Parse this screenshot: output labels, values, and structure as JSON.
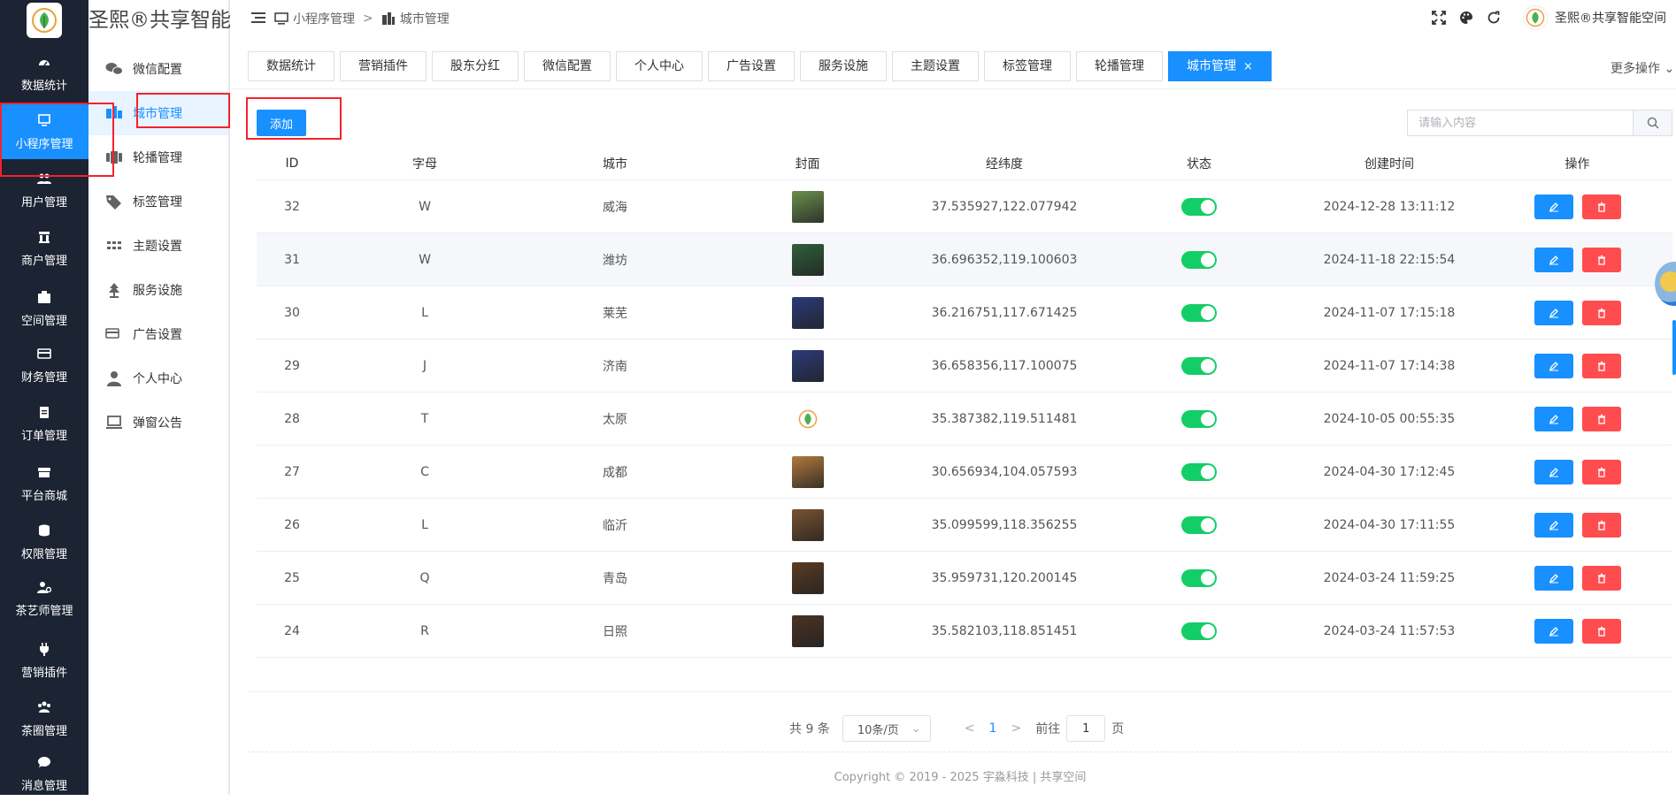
{
  "brand": {
    "name": "圣熙®共享智能..."
  },
  "rail": {
    "items": [
      {
        "label": "数据统计",
        "icon": "dashboard-icon"
      },
      {
        "label": "小程序管理",
        "icon": "monitor-icon",
        "active": true
      },
      {
        "label": "用户管理",
        "icon": "users-icon"
      },
      {
        "label": "商户管理",
        "icon": "building-icon"
      },
      {
        "label": "空间管理",
        "icon": "box-icon"
      },
      {
        "label": "财务管理",
        "icon": "card-icon"
      },
      {
        "label": "订单管理",
        "icon": "clipboard-icon"
      },
      {
        "label": "平台商城",
        "icon": "store-icon"
      },
      {
        "label": "权限管理",
        "icon": "database-icon"
      },
      {
        "label": "茶艺师管理",
        "icon": "user-gear-icon"
      },
      {
        "label": "营销插件",
        "icon": "plug-icon"
      },
      {
        "label": "茶圈管理",
        "icon": "group-icon"
      },
      {
        "label": "消息管理",
        "icon": "chat-icon"
      }
    ]
  },
  "submenu": {
    "items": [
      {
        "label": "微信配置",
        "icon": "wechat-icon"
      },
      {
        "label": "城市管理",
        "icon": "city-icon",
        "active": true
      },
      {
        "label": "轮播管理",
        "icon": "carousel-icon"
      },
      {
        "label": "标签管理",
        "icon": "tag-icon"
      },
      {
        "label": "主题设置",
        "icon": "grid-icon"
      },
      {
        "label": "服务设施",
        "icon": "tree-icon"
      },
      {
        "label": "广告设置",
        "icon": "card-icon"
      },
      {
        "label": "个人中心",
        "icon": "person-icon"
      },
      {
        "label": "弹窗公告",
        "icon": "laptop-icon"
      }
    ]
  },
  "breadcrumb": {
    "parent": "小程序管理",
    "separator": ">",
    "current": "城市管理"
  },
  "user": {
    "name": "圣熙®共享智能空间"
  },
  "tabs": {
    "items": [
      "数据统计",
      "营销插件",
      "股东分红",
      "微信配置",
      "个人中心",
      "广告设置",
      "服务设施",
      "主题设置",
      "标签管理",
      "轮播管理"
    ],
    "active_label": "城市管理",
    "close_glyph": "×",
    "more_label": "更多操作"
  },
  "toolbar": {
    "add_label": "添加",
    "search_placeholder": "请输入内容"
  },
  "table": {
    "columns": [
      "ID",
      "字母",
      "城市",
      "封面",
      "经纬度",
      "状态",
      "创建时间",
      "操作"
    ],
    "rows": [
      {
        "id": "32",
        "letter": "W",
        "city": "威海",
        "geo": "37.535927,122.077942",
        "status_on": true,
        "created": "2024-12-28 13:11:12",
        "cover_color": "#6b8f4e"
      },
      {
        "id": "31",
        "letter": "W",
        "city": "潍坊",
        "geo": "36.696352,119.100603",
        "status_on": true,
        "created": "2024-11-18 22:15:54",
        "cover_color": "#2f5f3a"
      },
      {
        "id": "30",
        "letter": "L",
        "city": "莱芜",
        "geo": "36.216751,117.671425",
        "status_on": true,
        "created": "2024-11-07 17:15:18",
        "cover_color": "#2b3a7a"
      },
      {
        "id": "29",
        "letter": "J",
        "city": "济南",
        "geo": "36.658356,117.100075",
        "status_on": true,
        "created": "2024-11-07 17:14:38",
        "cover_color": "#2b3a7a"
      },
      {
        "id": "28",
        "letter": "T",
        "city": "太原",
        "geo": "35.387382,119.511481",
        "status_on": true,
        "created": "2024-10-05 00:55:35",
        "cover_color": "logo"
      },
      {
        "id": "27",
        "letter": "C",
        "city": "成都",
        "geo": "30.656934,104.057593",
        "status_on": true,
        "created": "2024-04-30 17:12:45",
        "cover_color": "#b0793d"
      },
      {
        "id": "26",
        "letter": "L",
        "city": "临沂",
        "geo": "35.099599,118.356255",
        "status_on": true,
        "created": "2024-04-30 17:11:55",
        "cover_color": "#7a5232"
      },
      {
        "id": "25",
        "letter": "Q",
        "city": "青岛",
        "geo": "35.959731,120.200145",
        "status_on": true,
        "created": "2024-03-24 11:59:25",
        "cover_color": "#5a3b22"
      },
      {
        "id": "24",
        "letter": "R",
        "city": "日照",
        "geo": "35.582103,118.851451",
        "status_on": true,
        "created": "2024-03-24 11:57:53",
        "cover_color": "#4a3322"
      }
    ]
  },
  "pagination": {
    "total_text": "共 9 条",
    "page_size": "10条/页",
    "prev": "<",
    "current_page": "1",
    "next": ">",
    "goto_prefix": "前往",
    "goto_value": "1",
    "goto_suffix": "页"
  },
  "footer": {
    "text": "Copyright © 2019 - 2025 宇淼科技 | 共享空间"
  },
  "colors": {
    "primary": "#1890ff",
    "danger": "#ff4d4f",
    "switch_on": "#13ce66",
    "rail_bg": "#1c2333",
    "highlight": "#f5222d"
  }
}
